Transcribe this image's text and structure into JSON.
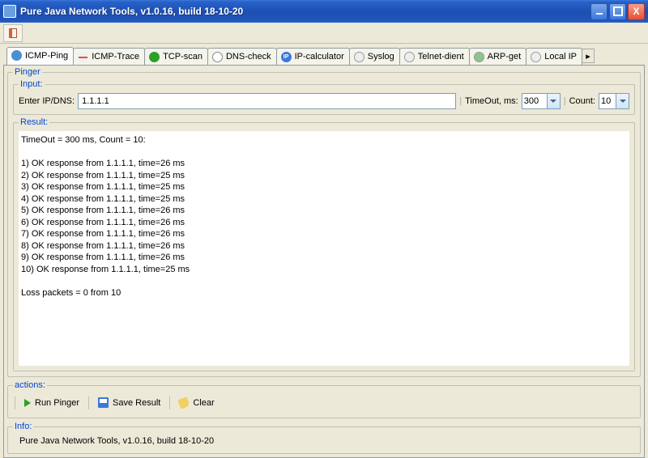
{
  "window": {
    "title": "Pure Java Network Tools,  v1.0.16, build 18-10-20",
    "close_label": "X"
  },
  "tabs": [
    {
      "label": "ICMP-Ping",
      "icon": "globe"
    },
    {
      "label": "ICMP-Trace",
      "icon": "trace"
    },
    {
      "label": "TCP-scan",
      "icon": "tcp"
    },
    {
      "label": "DNS-check",
      "icon": "dns"
    },
    {
      "label": "IP-calculator",
      "icon": "ip"
    },
    {
      "label": "Syslog",
      "icon": "sys"
    },
    {
      "label": "Telnet-dient",
      "icon": "tel"
    },
    {
      "label": "ARP-get",
      "icon": "arp"
    },
    {
      "label": "Local IP",
      "icon": "lip"
    }
  ],
  "pinger": {
    "legend": "Pinger",
    "input_legend": "Input:",
    "enter_label": "Enter IP/DNS:",
    "ip_value": "1.1.1.1",
    "timeout_label": "TimeOut, ms:",
    "timeout_value": "300",
    "count_label": "Count:",
    "count_value": "10",
    "result_legend": "Result:",
    "result_text": "TimeOut = 300 ms, Count = 10:\n\n1) OK response from 1.1.1.1, time=26 ms\n2) OK response from 1.1.1.1, time=25 ms\n3) OK response from 1.1.1.1, time=25 ms\n4) OK response from 1.1.1.1, time=25 ms\n5) OK response from 1.1.1.1, time=26 ms\n6) OK response from 1.1.1.1, time=26 ms\n7) OK response from 1.1.1.1, time=26 ms\n8) OK response from 1.1.1.1, time=26 ms\n9) OK response from 1.1.1.1, time=26 ms\n10) OK response from 1.1.1.1, time=25 ms\n\nLoss packets = 0 from 10"
  },
  "actions": {
    "legend": "actions:",
    "run": "Run Pinger",
    "save": "Save Result",
    "clear": "Clear"
  },
  "info": {
    "legend": "Info:",
    "text": "Pure Java Network Tools,  v1.0.16, build 18-10-20"
  }
}
